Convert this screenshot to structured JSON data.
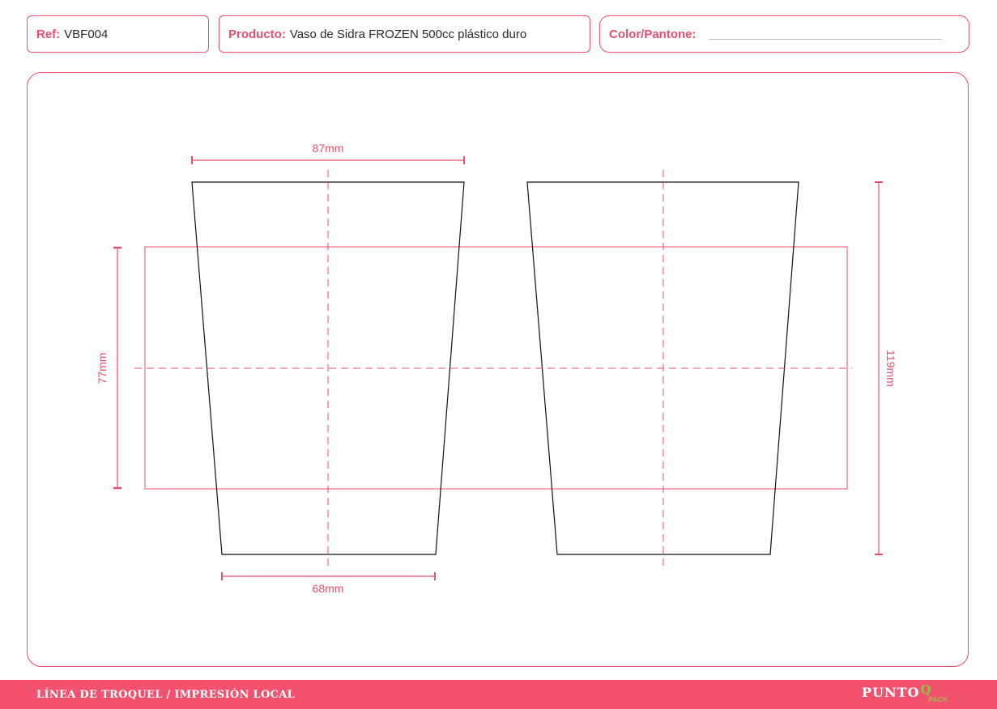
{
  "header": {
    "ref_label": "Ref:",
    "ref_value": "VBF004",
    "product_label": "Producto:",
    "product_value": "Vaso de Sidra FROZEN 500cc plástico duro",
    "color_label": "Color/Pantone:"
  },
  "dimensions": {
    "top_width": "87mm",
    "bottom_width": "68mm",
    "print_height": "77mm",
    "total_height": "119mm"
  },
  "footer": {
    "text": "LÍNEA DE TROQUEL / IMPRESIÓN LOCAL",
    "logo_main": "PUNTO",
    "logo_q": "Q",
    "logo_sub": "PACK"
  },
  "colors": {
    "accent": "#e8506e",
    "footer_bg": "#f2526e",
    "logo_green": "#86cc3a",
    "outline": "#111111"
  }
}
